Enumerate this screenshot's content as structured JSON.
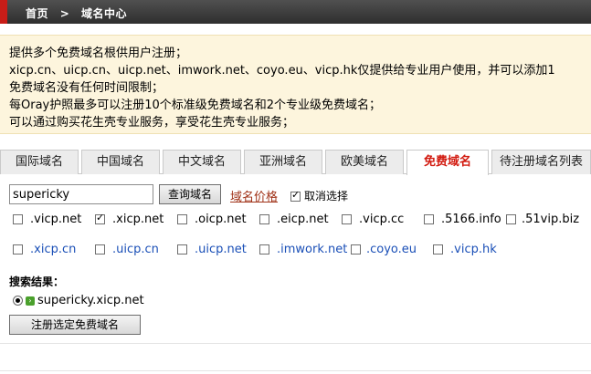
{
  "breadcrumb": {
    "home": "首页",
    "separator": ">",
    "current": "域名中心"
  },
  "notice": {
    "lines": [
      "提供多个免费域名根供用户注册；",
      "xicp.cn、uicp.cn、uicp.net、imwork.net、coyo.eu、vicp.hk仅提供给专业用户使用，并可以添加1",
      "免费域名没有任何时间限制；",
      "每Oray护照最多可以注册10个标准级免费域名和2个专业级免费域名；",
      "可以通过购买花生壳专业服务，享受花生壳专业服务；"
    ]
  },
  "tabs": [
    {
      "label": "国际域名",
      "active": false
    },
    {
      "label": "中国域名",
      "active": false
    },
    {
      "label": "中文域名",
      "active": false
    },
    {
      "label": "亚洲域名",
      "active": false
    },
    {
      "label": "欧美域名",
      "active": false
    },
    {
      "label": "免费域名",
      "active": true
    },
    {
      "label": "待注册域名列表",
      "active": false
    }
  ],
  "search": {
    "value": "supericky",
    "button_label": "查询域名",
    "price_link": "域名价格",
    "deselect_label": "取消选择",
    "deselect_checked": true
  },
  "domains_standard": [
    {
      "label": ".vicp.net",
      "checked": false
    },
    {
      "label": ".xicp.net",
      "checked": true
    },
    {
      "label": ".oicp.net",
      "checked": false
    },
    {
      "label": ".eicp.net",
      "checked": false
    },
    {
      "label": ".vicp.cc",
      "checked": false
    },
    {
      "label": ".5166.info",
      "checked": false
    },
    {
      "label": ".51vip.biz",
      "checked": false
    }
  ],
  "domains_pro": [
    {
      "label": ".xicp.cn",
      "checked": false
    },
    {
      "label": ".uicp.cn",
      "checked": false
    },
    {
      "label": ".uicp.net",
      "checked": false
    },
    {
      "label": ".imwork.net",
      "checked": false
    },
    {
      "label": ".coyo.eu",
      "checked": false
    },
    {
      "label": ".vicp.hk",
      "checked": false
    }
  ],
  "results": {
    "title": "搜索结果：",
    "items": [
      {
        "domain": "supericky.xicp.net",
        "selected": true
      }
    ],
    "register_button": "注册选定免费域名"
  },
  "colors": {
    "accent": "#d21b10",
    "notice_bg": "#fdf5dd",
    "link_blue": "#1a4fb7",
    "topbar": "#3c3c3c"
  }
}
